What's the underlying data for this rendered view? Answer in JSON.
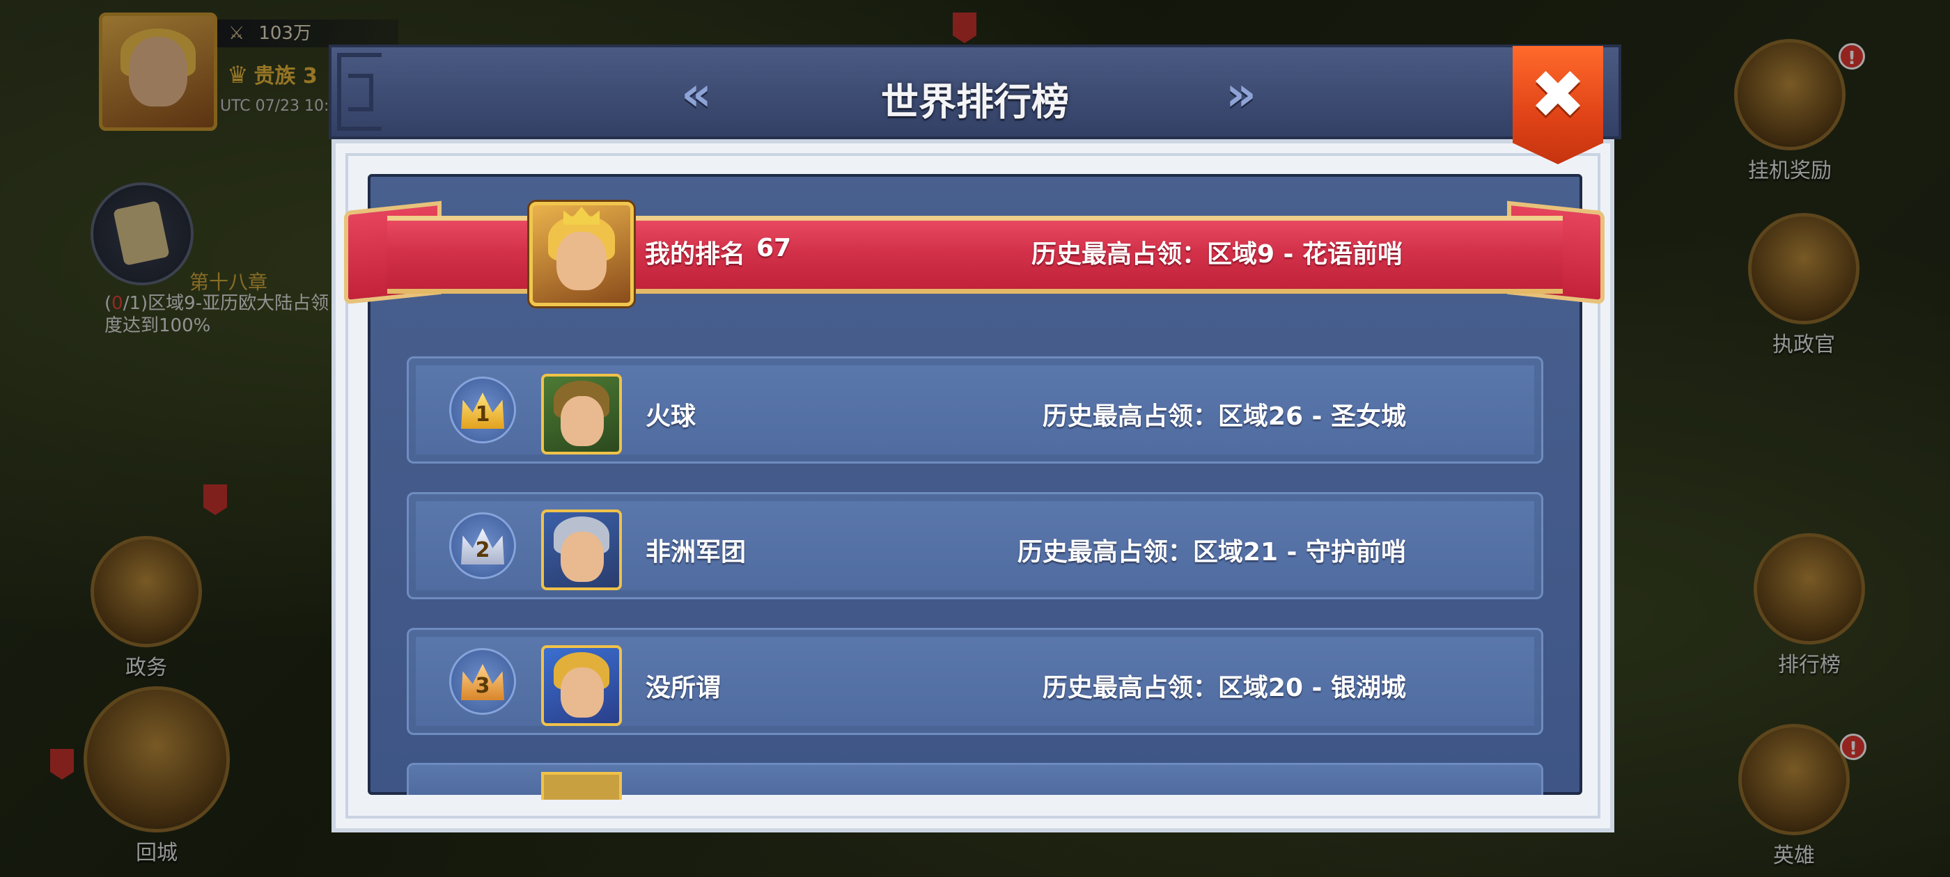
{
  "hud": {
    "power": "103万",
    "noble_title": "贵族 3",
    "time": "UTC 07/23 10:",
    "quest_chapter": "第十八章",
    "quest_progress_prefix": "(",
    "quest_progress_current": "0",
    "quest_progress_suffix": "/1)区域9-亚历欧大陆占领",
    "quest_progress_line2": "度达到100%",
    "right_buttons": [
      {
        "label": "挂机奖励",
        "badge": "!"
      },
      {
        "label": "执政官"
      },
      {
        "label": "排行榜"
      },
      {
        "label": "英雄",
        "badge": "!"
      }
    ],
    "left_buttons": [
      {
        "label": "政务"
      },
      {
        "label": "回城"
      }
    ]
  },
  "dialog": {
    "title": "世界排行榜",
    "prev_arrow": "«",
    "next_arrow": "»",
    "close_glyph": "✖"
  },
  "my_rank": {
    "label": "我的排名",
    "value": "67",
    "history": "历史最高占领：区域9 - 花语前哨"
  },
  "rankings": [
    {
      "rank": "1",
      "medal": "gold",
      "name": "火球",
      "history": "历史最高占领：区域26 - 圣女城",
      "hair_color": "#6a8a3a"
    },
    {
      "rank": "2",
      "medal": "silver",
      "name": "非洲军团",
      "history": "历史最高占领：区域21 - 守护前哨",
      "hair_color": "#b0b7c6"
    },
    {
      "rank": "3",
      "medal": "bronze",
      "name": "没所谓",
      "history": "历史最高占领：区域20 - 银湖城",
      "hair_color": "#7a4a2a"
    }
  ],
  "colors": {
    "ribbon_red": "#d23149",
    "panel_blue": "#49608f",
    "close_orange": "#e04317",
    "gold_border": "#f0c24a"
  }
}
